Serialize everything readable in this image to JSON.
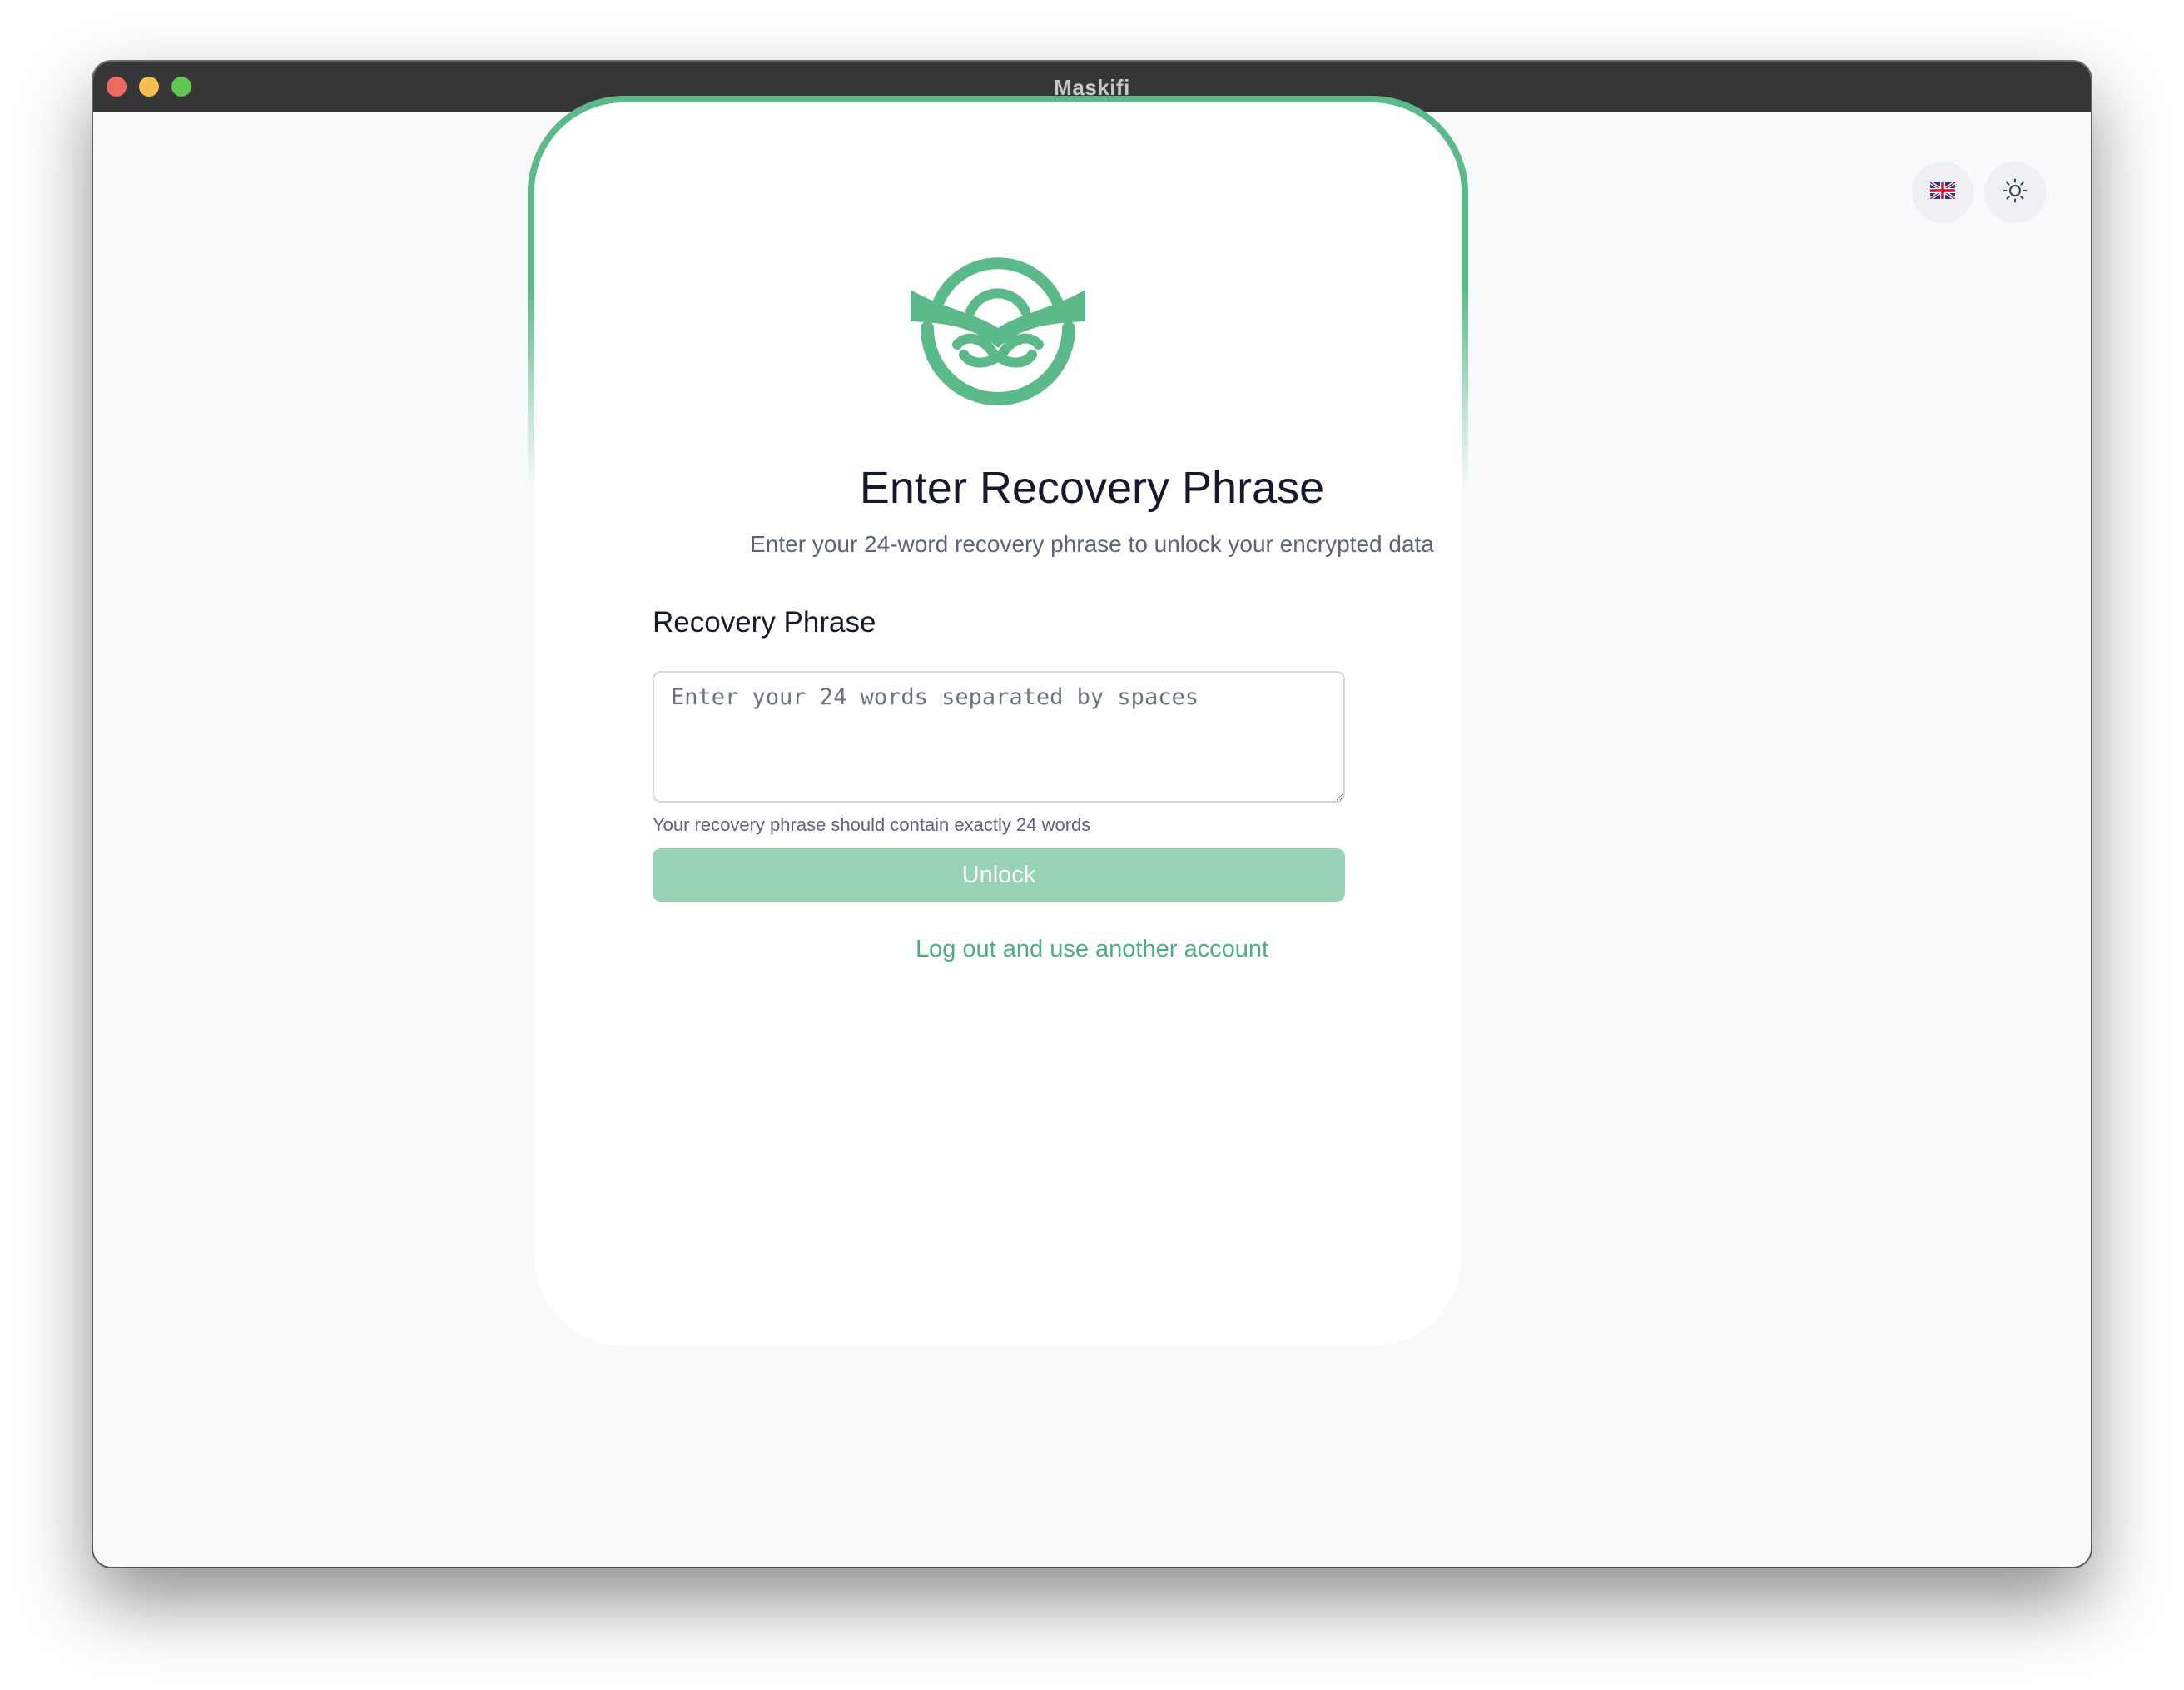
{
  "window": {
    "title": "Maskifi"
  },
  "toolbar": {
    "language_icon": "uk-flag-icon",
    "theme_icon": "sun-icon"
  },
  "colors": {
    "accent": "#5cb98a",
    "button_disabled": "#98d3b5",
    "link": "#4caf7f"
  },
  "card": {
    "logo_icon": "maskifi-logo",
    "heading": "Enter Recovery Phrase",
    "subtitle": "Enter your 24-word recovery phrase to unlock your encrypted data",
    "field_label": "Recovery Phrase",
    "field_value": "",
    "field_placeholder": "Enter your 24 words separated by spaces",
    "helper_text": "Your recovery phrase should contain exactly 24 words",
    "unlock_label": "Unlock",
    "logout_label": "Log out and use another account"
  }
}
